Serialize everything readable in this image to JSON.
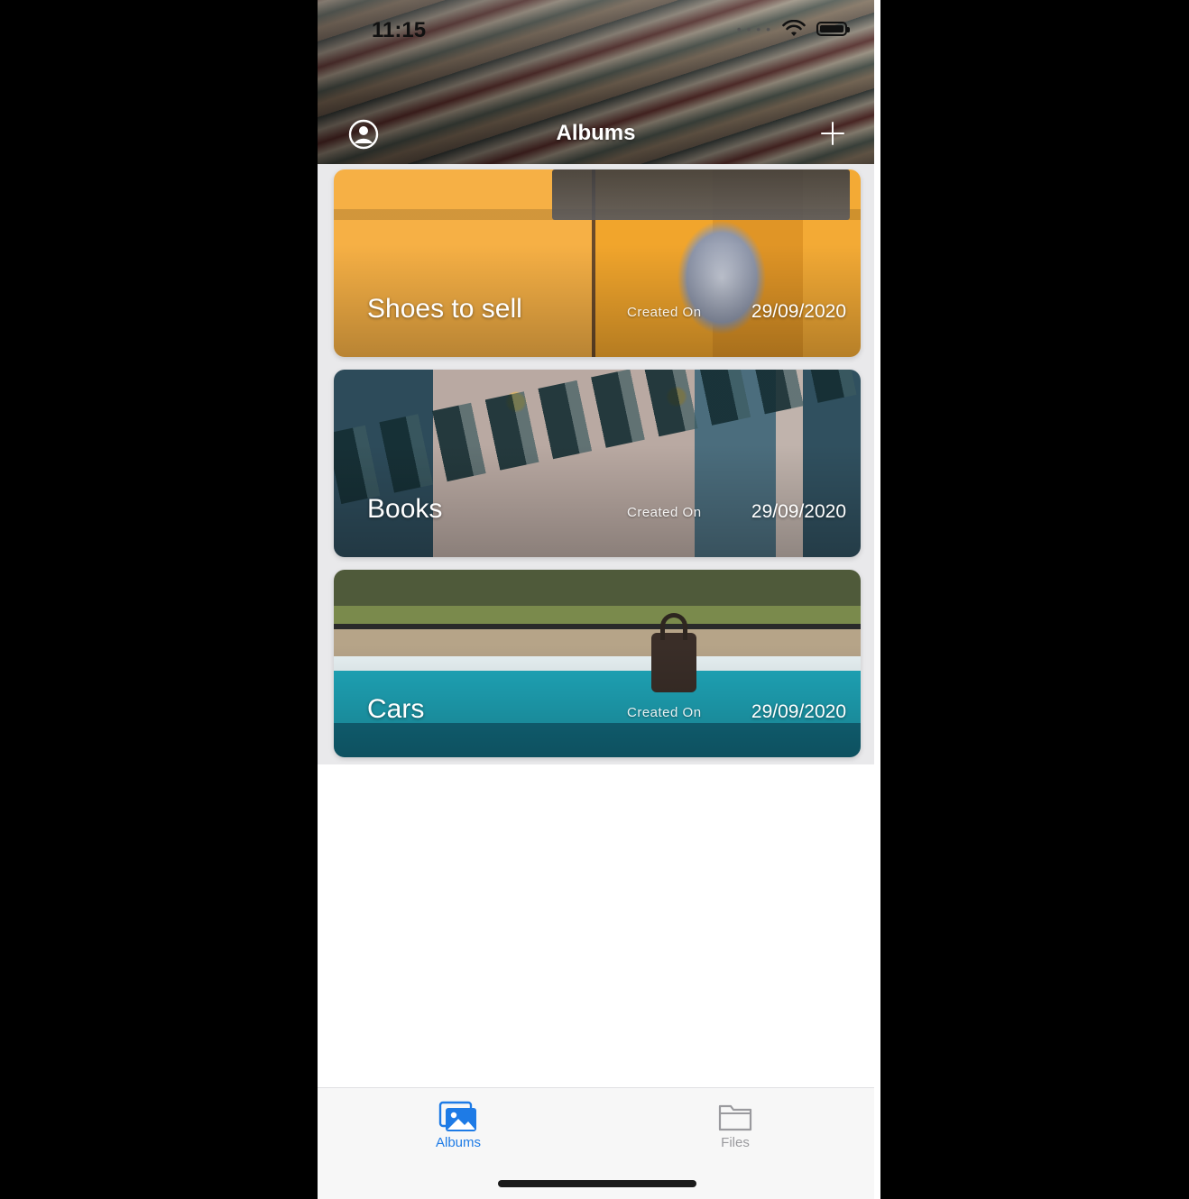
{
  "status_bar": {
    "time": "11:15"
  },
  "nav": {
    "title": "Albums",
    "profile_icon": "person-circle-icon",
    "add_icon": "plus-icon"
  },
  "albums": [
    {
      "name": "Shoes to sell",
      "created_label": "Created On",
      "created_date": "29/09/2020"
    },
    {
      "name": "Books",
      "created_label": "Created On",
      "created_date": "29/09/2020"
    },
    {
      "name": "Cars",
      "created_label": "Created On",
      "created_date": "29/09/2020"
    }
  ],
  "tabbar": {
    "albums_label": "Albums",
    "files_label": "Files",
    "active_color": "#1e7be6",
    "inactive_color": "#9a9a9e"
  }
}
